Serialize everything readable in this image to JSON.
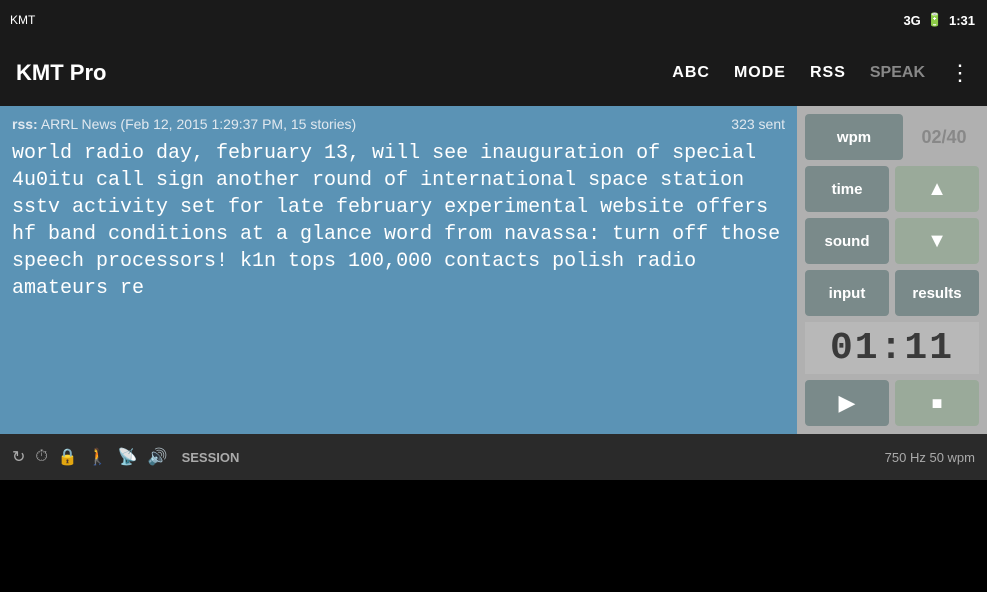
{
  "statusBar": {
    "appName": "KMT",
    "network": "3G",
    "time": "1:31"
  },
  "appBar": {
    "title": "KMT Pro",
    "abc": "ABC",
    "mode": "MODE",
    "rss": "RSS",
    "speak": "SPEAK"
  },
  "rssHeader": {
    "label": "rss:",
    "info": "ARRL News (Feb 12, 2015 1:29:37 PM, 15 stories)",
    "sent": "323 sent"
  },
  "newsText": "world radio day, february 13, will see inauguration of special 4u0itu call sign another round of international space station sstv activity set for late february experimental website offers hf band conditions at a glance word from navassa: turn off those speech processors! k1n tops 100,000 contacts polish radio amateurs re",
  "controls": {
    "wpm_label": "wpm",
    "wpm_value": "02/40",
    "time_label": "time",
    "sound_label": "sound",
    "input_label": "input",
    "results_label": "results",
    "timer": "01:11"
  },
  "bottomBar": {
    "session_label": "SESSION",
    "freq_info": "750 Hz  50 wpm"
  }
}
